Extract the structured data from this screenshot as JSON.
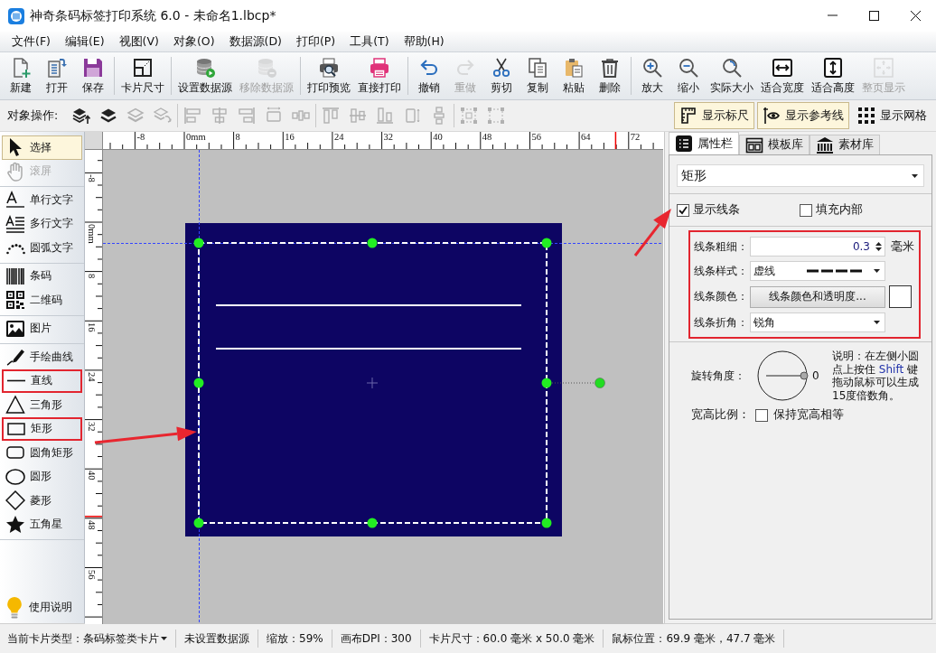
{
  "window": {
    "title": "神奇条码标签打印系统 6.0 - 未命名1.lbcp*"
  },
  "menu": [
    "文件(F)",
    "编辑(E)",
    "视图(V)",
    "对象(O)",
    "数据源(D)",
    "打印(P)",
    "工具(T)",
    "帮助(H)"
  ],
  "toolbar": [
    [
      {
        "label": "新建",
        "disabled": false
      },
      {
        "label": "打开",
        "disabled": false
      },
      {
        "label": "保存",
        "disabled": false
      }
    ],
    [
      {
        "label": "卡片尺寸",
        "disabled": false
      }
    ],
    [
      {
        "label": "设置数据源",
        "disabled": false
      },
      {
        "label": "移除数据源",
        "disabled": true
      }
    ],
    [
      {
        "label": "打印预览",
        "disabled": false
      },
      {
        "label": "直接打印",
        "disabled": false
      }
    ],
    [
      {
        "label": "撤销",
        "disabled": false
      },
      {
        "label": "重做",
        "disabled": true
      },
      {
        "label": "剪切",
        "disabled": false
      },
      {
        "label": "复制",
        "disabled": false
      },
      {
        "label": "粘贴",
        "disabled": false
      },
      {
        "label": "删除",
        "disabled": false
      }
    ],
    [
      {
        "label": "放大",
        "disabled": false
      },
      {
        "label": "缩小",
        "disabled": false
      },
      {
        "label": "实际大小",
        "disabled": false
      },
      {
        "label": "适合宽度",
        "disabled": false
      },
      {
        "label": "适合高度",
        "disabled": false
      },
      {
        "label": "整页显示",
        "disabled": true
      }
    ]
  ],
  "object_bar": {
    "label": "对象操作:",
    "tools": [
      [
        {
          "disabled": false
        },
        {
          "disabled": false
        },
        {
          "disabled": true
        },
        {
          "disabled": true
        }
      ],
      [
        {
          "disabled": true
        },
        {
          "disabled": true
        },
        {
          "disabled": true
        },
        {
          "disabled": true
        },
        {
          "disabled": true
        }
      ],
      [
        {
          "disabled": true
        },
        {
          "disabled": true
        },
        {
          "disabled": true
        },
        {
          "disabled": true
        },
        {
          "disabled": true
        }
      ],
      [
        {
          "disabled": true
        },
        {
          "disabled": true
        }
      ]
    ],
    "toggles": [
      {
        "label": "显示标尺",
        "on": true
      },
      {
        "label": "显示参考线",
        "on": true
      },
      {
        "label": "显示网格",
        "on": false
      }
    ]
  },
  "toolbox": {
    "groups": [
      [
        {
          "label": "选择",
          "selected": true,
          "disabled": false,
          "marked": false
        },
        {
          "label": "滚屏",
          "selected": false,
          "disabled": true,
          "marked": false
        }
      ],
      [
        {
          "label": "单行文字",
          "selected": false,
          "disabled": false,
          "marked": false
        },
        {
          "label": "多行文字",
          "selected": false,
          "disabled": false,
          "marked": false
        },
        {
          "label": "圆弧文字",
          "selected": false,
          "disabled": false,
          "marked": false
        }
      ],
      [
        {
          "label": "条码",
          "selected": false,
          "disabled": false,
          "marked": false
        },
        {
          "label": "二维码",
          "selected": false,
          "disabled": false,
          "marked": false
        }
      ],
      [
        {
          "label": "图片",
          "selected": false,
          "disabled": false,
          "marked": false
        }
      ],
      [
        {
          "label": "手绘曲线",
          "selected": false,
          "disabled": false,
          "marked": false
        },
        {
          "label": "直线",
          "selected": false,
          "disabled": false,
          "marked": true
        },
        {
          "label": "三角形",
          "selected": false,
          "disabled": false,
          "marked": false
        },
        {
          "label": "矩形",
          "selected": false,
          "disabled": false,
          "marked": true
        },
        {
          "label": "圆角矩形",
          "selected": false,
          "disabled": false,
          "marked": false
        },
        {
          "label": "圆形",
          "selected": false,
          "disabled": false,
          "marked": false
        },
        {
          "label": "菱形",
          "selected": false,
          "disabled": false,
          "marked": false
        },
        {
          "label": "五角星",
          "selected": false,
          "disabled": false,
          "marked": false
        }
      ]
    ],
    "help": "使用说明"
  },
  "rulers": {
    "horizontal": [
      "-8",
      "0mm",
      "8",
      "16",
      "24",
      "32",
      "40",
      "48",
      "56",
      "64",
      "72"
    ],
    "vertical": [
      "-8",
      "0mm",
      "8",
      "16",
      "24",
      "32",
      "40",
      "48",
      "56"
    ]
  },
  "panel": {
    "tabs": [
      {
        "label": "属性栏",
        "selected": true
      },
      {
        "label": "模板库",
        "selected": false
      },
      {
        "label": "素材库",
        "selected": false
      }
    ],
    "object_type": "矩形",
    "show_line": {
      "label": "显示线条",
      "checked": true
    },
    "fill": {
      "label": "填充内部",
      "checked": false
    },
    "line_settings": {
      "marked": true,
      "width": {
        "label": "线条粗细：",
        "value": "0.3",
        "unit": "毫米"
      },
      "style": {
        "label": "线条样式：",
        "value": "虚线"
      },
      "color": {
        "label": "线条颜色：",
        "button": "线条颜色和透明度...",
        "color": "#ffffff"
      },
      "join": {
        "label": "线条折角：",
        "value": "锐角"
      }
    },
    "rotation": {
      "label": "旋转角度：",
      "value": "0",
      "note": [
        {
          "text": "说明：在左侧小圆点上按住 ",
          "emphasis": false
        },
        {
          "text": "Shift",
          "emphasis": true
        },
        {
          "text": " 键拖动鼠标可以生成15度倍数角。",
          "emphasis": false
        }
      ]
    },
    "aspect": {
      "label": "宽高比例：",
      "checkbox": {
        "label": "保持宽高相等",
        "checked": false
      }
    }
  },
  "status_bar": [
    {
      "text": "当前卡片类型：条码标签类卡片",
      "dropdown": true
    },
    {
      "text": "未设置数据源",
      "dropdown": false
    },
    {
      "text": "缩放：59%",
      "dropdown": false
    },
    {
      "text": "画布DPI：300",
      "dropdown": false
    },
    {
      "text": "卡片尺寸：60.0 毫米 x 50.0 毫米",
      "dropdown": false
    },
    {
      "text": "鼠标位置：69.9 毫米，47.7 毫米",
      "dropdown": false
    }
  ]
}
